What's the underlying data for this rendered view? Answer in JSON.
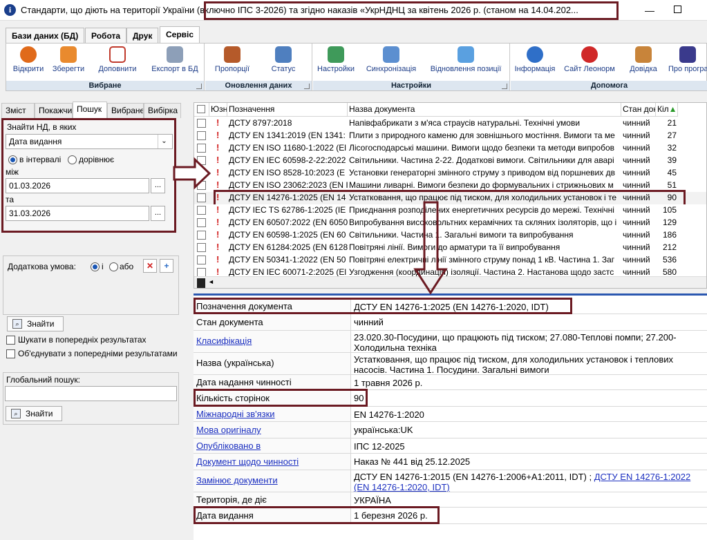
{
  "window": {
    "title_prefix": "Стандарти, що діють на території України",
    "title_rest": " (включно ІПС 3-2026) та згідно наказів «УкрНДНЦ за  квітень 2026 р. (станом на  14.04.202...",
    "minimize": "—"
  },
  "ribbon": {
    "tabs": [
      "Бази даних (БД)",
      "Робота",
      "Друк",
      "Сервіс"
    ],
    "groups": [
      {
        "label": "Вибране",
        "buttons": [
          "Відкрити",
          "Зберегти",
          "Доповнити",
          "Експорт в БД"
        ]
      },
      {
        "label": "Оновлення даних",
        "buttons": [
          "Пропорції",
          "Статус"
        ]
      },
      {
        "label": "Настройки",
        "buttons": [
          "Настройки",
          "Синхронізація",
          "Відновлення позиції"
        ]
      },
      {
        "label": "Допомога",
        "buttons": [
          "Інформація",
          "Сайт  Леонорм",
          "Довідка",
          "Про програму"
        ]
      }
    ]
  },
  "left_panel": {
    "tabs": [
      "Зміст",
      "Покажчи",
      "Пошук",
      "Вибране",
      "Вибірка"
    ],
    "find_label": "Знайти НД, в яких",
    "field_select": "Дата видання",
    "radio_interval": "в інтервалі",
    "radio_equal": "дорівнює",
    "between_label": "між",
    "date_from": "01.03.2026",
    "and_label": "та",
    "date_to": "31.03.2026",
    "dots": "...",
    "extra_condition": "Додаткова умова:",
    "radio_and": "і",
    "radio_or": "або",
    "find_button": "Знайти",
    "search_prev": "Шукати в попередніх результатах",
    "merge_prev": "Об'єднувати з попередніми результатами",
    "global_search_label": "Глобальний пошук:",
    "global_search_value": "",
    "global_find_button": "Знайти"
  },
  "table": {
    "headers": {
      "check": "",
      "flag": "Юзн",
      "designation": "Позначення",
      "name": "Назва документа",
      "state": "Стан док",
      "pages": "Кіл"
    },
    "rows": [
      {
        "designation": "ДСТУ 8797:2018",
        "name": "Напівфабрикати з м'яса страусів натуральні. Технічні умови",
        "state": "чинний",
        "pages": "21"
      },
      {
        "designation": "ДСТУ EN 1341:2019 (EN 1341:",
        "name": "Плити з природного каменю для зовнішнього мостіння. Вимоги та ме",
        "state": "чинний",
        "pages": "27"
      },
      {
        "designation": "ДСТУ EN ISO 11680-1:2022 (El",
        "name": "Лісогосподарські машини. Вимоги щодо безпеки та методи випробов",
        "state": "чинний",
        "pages": "32"
      },
      {
        "designation": "ДСТУ EN IEC 60598-2-22:2022",
        "name": "Світильники. Частина 2-22. Додаткові вимоги. Світильники для аварі",
        "state": "чинний",
        "pages": "39"
      },
      {
        "designation": "ДСТУ EN ISO 8528-10:2023 (E",
        "name": "Установки генераторні змінного струму з приводом від поршневих дв",
        "state": "чинний",
        "pages": "45"
      },
      {
        "designation": "ДСТУ EN ISO 23062:2023 (EN I",
        "name": "Машини ливарні. Вимоги безпеки до формувальних і стрижньових м",
        "state": "чинний",
        "pages": "51"
      },
      {
        "designation": "ДСТУ EN 14276-1:2025 (EN 14",
        "name": "Устатковання, що працює під тиском, для холодильних установок і те",
        "state": "чинний",
        "pages": "90"
      },
      {
        "designation": "ДСТУ IEC TS 62786-1:2025 (IE",
        "name": "Приєднання розподілених енергетичних ресурсів до мережі. Технічні",
        "state": "чинний",
        "pages": "105"
      },
      {
        "designation": "ДСТУ EN 60507:2022 (EN 6050",
        "name": "Випробування високовольтних керамічних та скляних ізоляторів, що і",
        "state": "чинний",
        "pages": "129"
      },
      {
        "designation": "ДСТУ EN 60598-1:2025 (EN 60",
        "name": "Світильники. Частина 1. Загальні вимоги та випробування",
        "state": "чинний",
        "pages": "186"
      },
      {
        "designation": "ДСТУ EN 61284:2025 (EN 6128",
        "name": "Повітряні лінії. Вимоги до арматури та її випробування",
        "state": "чинний",
        "pages": "212"
      },
      {
        "designation": "ДСТУ EN 50341-1:2022 (EN 50",
        "name": "Повітряні електричні лінії змінного струму понад 1 кВ. Частина 1. Заг",
        "state": "чинний",
        "pages": "536"
      },
      {
        "designation": "ДСТУ EN IEC 60071-2:2025 (El",
        "name": "Узгодження (координація) ізоляції. Частина 2. Настанова щодо застс",
        "state": "чинний",
        "pages": "580"
      }
    ],
    "selected_index": 6,
    "flag_symbol": "!"
  },
  "details": {
    "rows": [
      {
        "label": "Позначення документа",
        "value": "ДСТУ EN 14276-1:2025 (EN 14276-1:2020, IDT)",
        "link": false
      },
      {
        "label": "Стан документа",
        "value": "чинний",
        "link": false
      },
      {
        "label": "Класифікація",
        "value": "23.020.30-Посудини, що працюють під тиском; 27.080-Теплові помпи; 27.200-Холодильна техніка",
        "link": true
      },
      {
        "label": "Назва (українська)",
        "value": "Устатковання, що працює під тиском, для холодильних установок і теплових насосів. Частина 1. Посудини. Загальні вимоги",
        "link": false
      },
      {
        "label": "Дата надання чинності",
        "value": "1 травня 2026 р.",
        "link": false
      },
      {
        "label": "Кількість сторінок",
        "value": "90",
        "link": false
      },
      {
        "label": "Міжнародні зв'язки",
        "value": "EN 14276-1:2020",
        "link": true
      },
      {
        "label": "Мова оригіналу",
        "value": "українська:UK",
        "link": true
      },
      {
        "label": "Опубліковано в",
        "value": "ІПС 12-2025",
        "link": true
      },
      {
        "label": "Документ щодо чинності",
        "value": "Наказ № 441 від 25.12.2025",
        "link": true
      },
      {
        "label": "Замінює документи",
        "value": "ДСТУ EN 14276-1:2015 (EN 14276-1:2006+A1:2011, IDT) ; ",
        "value_link": "ДСТУ EN 14276-1:2022 (EN 14276-1:2020, IDT)",
        "link": true
      },
      {
        "label": "Територія, де діє",
        "value": "УКРАЇНА",
        "link": false
      },
      {
        "label": "Дата видання",
        "value": "1 березня 2026 р.",
        "link": false
      }
    ]
  },
  "colors": {
    "highlight": "#6b1a22",
    "link": "#1b2fc0",
    "accent": "#2b58b0"
  }
}
